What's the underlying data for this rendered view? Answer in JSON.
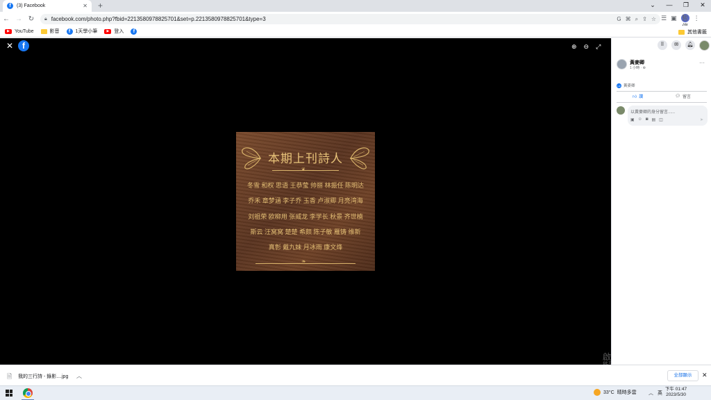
{
  "browser": {
    "tab_title": "(3) Facebook",
    "url": "facebook.com/photo.php?fbid=2213580978825701&set=p.2213580978825701&type=3",
    "profile_label": "暫停"
  },
  "bookmarks": [
    {
      "label": "YouTube",
      "icon": "youtube-icon"
    },
    {
      "label": "影音",
      "icon": "folder-icon"
    },
    {
      "label": "1天學小筆",
      "icon": "facebook-icon"
    },
    {
      "label": "登入",
      "icon": "youtube-icon"
    }
  ],
  "bookmarks_other": "其他書籤",
  "plaque": {
    "title": "本期上刊詩人",
    "rows": [
      "冬雪 和权 思语 王恭莹 帅丽 林振任 陈明达",
      "乔禾 章梦涵 李子乔 玉香 卢淑卿 月亮湾海",
      "刘祖荣 欧柳用 张威龙 李学长 秋景 齐世楠",
      "斯云 汪窝窝 楚楚 希颜 陈子敏 雁铸 维新",
      "真彰 戴九妹 月冰雨 康文烽"
    ]
  },
  "post": {
    "author": "黃麥卿",
    "time": "1 小時 · ⊕",
    "likes": "黃麥卿",
    "like_label": "讚",
    "comment_label": "留言",
    "comment_placeholder": "以黃麥卿的身分留言......"
  },
  "watermark": {
    "line1": "啟用 Windows",
    "line2": "移至 [設定] 以啟用 Windows。"
  },
  "download": {
    "filename": "我的三行詩 - 錄影....jpg",
    "show_all": "全部顯示"
  },
  "taskbar": {
    "temperature": "33°C",
    "weather": "晴時多雲",
    "ime": "英",
    "time": "下午 01:47",
    "date": "2023/5/30"
  },
  "colors": {
    "facebook_blue": "#1877f2",
    "viewer_bg": "#000000",
    "plaque_gold": "#e3be74"
  }
}
